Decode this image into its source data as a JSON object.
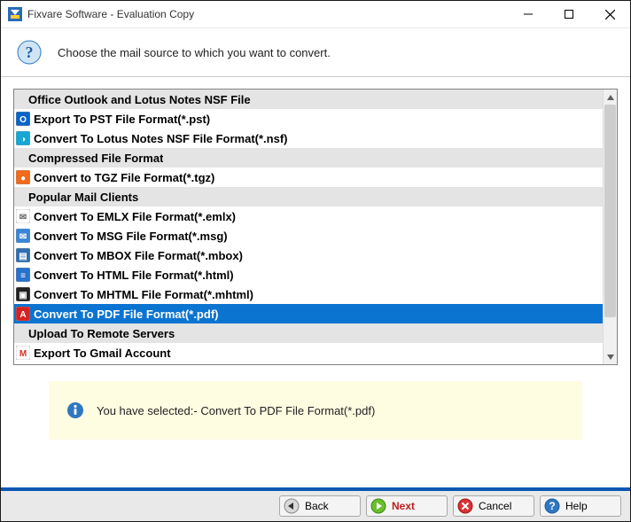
{
  "window": {
    "title": "Fixvare Software - Evaluation Copy"
  },
  "instruction": "Choose the mail source to which you want to convert.",
  "list": {
    "selected_index": 11,
    "rows": [
      {
        "type": "header",
        "label": "Office Outlook and Lotus Notes NSF File"
      },
      {
        "type": "item",
        "icon": "pst-icon",
        "label": "Export To PST File Format(*.pst)"
      },
      {
        "type": "item",
        "icon": "nsf-icon",
        "label": "Convert To Lotus Notes NSF File Format(*.nsf)"
      },
      {
        "type": "header",
        "label": "Compressed File Format"
      },
      {
        "type": "item",
        "icon": "tgz-icon",
        "label": "Convert to TGZ File Format(*.tgz)"
      },
      {
        "type": "header",
        "label": "Popular Mail Clients"
      },
      {
        "type": "item",
        "icon": "emlx-icon",
        "label": "Convert To EMLX File Format(*.emlx)"
      },
      {
        "type": "item",
        "icon": "msg-icon",
        "label": "Convert To MSG File Format(*.msg)"
      },
      {
        "type": "item",
        "icon": "mbox-icon",
        "label": "Convert To MBOX File Format(*.mbox)"
      },
      {
        "type": "item",
        "icon": "html-icon",
        "label": "Convert To HTML File Format(*.html)"
      },
      {
        "type": "item",
        "icon": "mhtml-icon",
        "label": "Convert To MHTML File Format(*.mhtml)"
      },
      {
        "type": "item",
        "icon": "pdf-icon",
        "label": "Convert To PDF File Format(*.pdf)"
      },
      {
        "type": "header",
        "label": "Upload To Remote Servers"
      },
      {
        "type": "item",
        "icon": "gmail-icon",
        "label": "Export To Gmail Account"
      }
    ]
  },
  "status": {
    "prefix": "You have selected:- ",
    "value": "Convert To PDF File Format(*.pdf)"
  },
  "buttons": {
    "back": "Back",
    "next": "Next",
    "cancel": "Cancel",
    "help": "Help"
  },
  "icons": {
    "pst-icon": {
      "bg": "#0a64c8",
      "fg": "#fff",
      "glyph": "O"
    },
    "nsf-icon": {
      "bg": "#17a7d4",
      "fg": "#fff",
      "glyph": "◑"
    },
    "tgz-icon": {
      "bg": "#f26a1b",
      "fg": "#fff",
      "glyph": "●"
    },
    "emlx-icon": {
      "bg": "#ffffff",
      "fg": "#666",
      "glyph": "✉"
    },
    "msg-icon": {
      "bg": "#3a85d6",
      "fg": "#fff",
      "glyph": "✉"
    },
    "mbox-icon": {
      "bg": "#2f6fb0",
      "fg": "#fff",
      "glyph": "▤"
    },
    "html-icon": {
      "bg": "#2971cc",
      "fg": "#fff",
      "glyph": "≡"
    },
    "mhtml-icon": {
      "bg": "#222",
      "fg": "#fff",
      "glyph": "▣"
    },
    "pdf-icon": {
      "bg": "#d62222",
      "fg": "#fff",
      "glyph": "A"
    },
    "gmail-icon": {
      "bg": "#ffffff",
      "fg": "#d93025",
      "glyph": "M"
    }
  }
}
